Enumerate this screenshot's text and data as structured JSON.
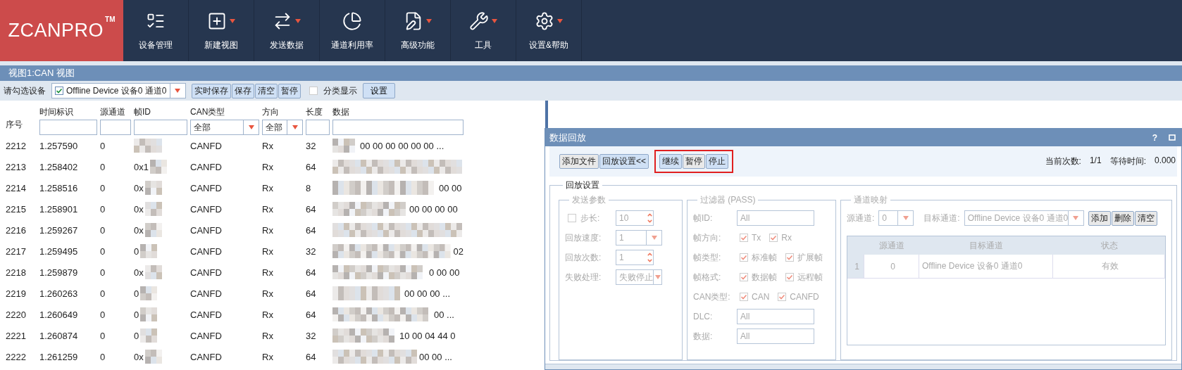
{
  "app": {
    "logo": "ZCANPRO",
    "trademark": "TM"
  },
  "toolbar": [
    {
      "label": "设备管理",
      "dropdown": false
    },
    {
      "label": "新建视图",
      "dropdown": true
    },
    {
      "label": "发送数据",
      "dropdown": true
    },
    {
      "label": "通道利用率",
      "dropdown": false
    },
    {
      "label": "高级功能",
      "dropdown": true
    },
    {
      "label": "工具",
      "dropdown": true
    },
    {
      "label": "设置&帮助",
      "dropdown": true
    }
  ],
  "view": {
    "title": "视图1:CAN 视图",
    "device_label": "请勾选设备",
    "device": {
      "value": "Offline Device 设备0 通道0",
      "checked": true
    },
    "buttons": [
      "实时保存",
      "保存",
      "清空",
      "暂停"
    ],
    "classify": {
      "label": "分类显示",
      "checked": false
    },
    "settings_button": "设置"
  },
  "table": {
    "columns": [
      {
        "label": "序号",
        "kind": "plain"
      },
      {
        "label": "时间标识",
        "kind": "text"
      },
      {
        "label": "源通道",
        "kind": "text"
      },
      {
        "label": "帧ID",
        "kind": "text"
      },
      {
        "label": "CAN类型",
        "kind": "select",
        "value": "全部"
      },
      {
        "label": "方向",
        "kind": "select",
        "value": "全部"
      },
      {
        "label": "长度",
        "kind": "text"
      },
      {
        "label": "数据",
        "kind": "text"
      }
    ],
    "rows": [
      {
        "seq": "2212",
        "time": "1.257590",
        "channel": "0",
        "id": "",
        "type": "CANFD",
        "dir": "Rx",
        "len": "32",
        "data": "00 00 00 00 00 00 ..."
      },
      {
        "seq": "2213",
        "time": "1.258402",
        "channel": "0",
        "id": "0x1",
        "type": "CANFD",
        "dir": "Rx",
        "len": "64",
        "data": ""
      },
      {
        "seq": "2214",
        "time": "1.258516",
        "channel": "0",
        "id": "0x",
        "type": "CANFD",
        "dir": "Rx",
        "len": "8",
        "data": "00 00"
      },
      {
        "seq": "2215",
        "time": "1.258901",
        "channel": "0",
        "id": "0x",
        "type": "CANFD",
        "dir": "Rx",
        "len": "64",
        "data": "00 00 00 00"
      },
      {
        "seq": "2216",
        "time": "1.259267",
        "channel": "0",
        "id": "0x",
        "type": "CANFD",
        "dir": "Rx",
        "len": "64",
        "data": ""
      },
      {
        "seq": "2217",
        "time": "1.259495",
        "channel": "0",
        "id": "0",
        "type": "CANFD",
        "dir": "Rx",
        "len": "32",
        "data": "02"
      },
      {
        "seq": "2218",
        "time": "1.259879",
        "channel": "0",
        "id": "0x",
        "type": "CANFD",
        "dir": "Rx",
        "len": "64",
        "data": "0 00 00"
      },
      {
        "seq": "2219",
        "time": "1.260263",
        "channel": "0",
        "id": "0",
        "type": "CANFD",
        "dir": "Rx",
        "len": "64",
        "data": "00 00 00 ..."
      },
      {
        "seq": "2220",
        "time": "1.260649",
        "channel": "0",
        "id": "0",
        "type": "CANFD",
        "dir": "Rx",
        "len": "64",
        "data": "00 ..."
      },
      {
        "seq": "2221",
        "time": "1.260874",
        "channel": "0",
        "id": "0",
        "type": "CANFD",
        "dir": "Rx",
        "len": "32",
        "data": "10 00 04 44 0"
      },
      {
        "seq": "2222",
        "time": "1.261259",
        "channel": "0",
        "id": "0x",
        "type": "CANFD",
        "dir": "Rx",
        "len": "64",
        "data": "00 00 ..."
      }
    ]
  },
  "playback": {
    "title": "数据回放",
    "help": "?",
    "file_buttons": [
      "添加文件",
      "回放设置<<"
    ],
    "control_buttons": [
      {
        "label": "继续",
        "active": true
      },
      {
        "label": "暂停",
        "active": false
      },
      {
        "label": "停止",
        "active": true
      }
    ],
    "status": {
      "count_label": "当前次数:",
      "count": "1/1",
      "wait_label": "等待时间:",
      "wait": "0.000"
    },
    "settings": {
      "title": "回放设置",
      "disabled": true,
      "send": {
        "title": "发送参数",
        "fields": [
          {
            "label": "步长:",
            "kind": "spin",
            "value": "10",
            "checked": false
          },
          {
            "label": "回放速度:",
            "kind": "select",
            "value": "1"
          },
          {
            "label": "回放次数:",
            "kind": "spin",
            "value": "1"
          },
          {
            "label": "失败处理:",
            "kind": "select",
            "value": "失败停止"
          }
        ]
      },
      "filter": {
        "title": "过滤器 (PASS)",
        "fields": [
          {
            "label": "帧ID:",
            "kind": "text",
            "value": "All"
          },
          {
            "label": "帧方向:",
            "kind": "checks",
            "options": [
              {
                "label": "Tx",
                "checked": true
              },
              {
                "label": "Rx",
                "checked": true
              }
            ]
          },
          {
            "label": "帧类型:",
            "kind": "checks",
            "options": [
              {
                "label": "标准帧",
                "checked": true
              },
              {
                "label": "扩展帧",
                "checked": true
              }
            ]
          },
          {
            "label": "帧格式:",
            "kind": "checks",
            "options": [
              {
                "label": "数据帧",
                "checked": true
              },
              {
                "label": "远程帧",
                "checked": true
              }
            ]
          },
          {
            "label": "CAN类型:",
            "kind": "checks",
            "options": [
              {
                "label": "CAN",
                "checked": true
              },
              {
                "label": "CANFD",
                "checked": true
              }
            ]
          },
          {
            "label": "DLC:",
            "kind": "text",
            "value": "All"
          },
          {
            "label": "数据:",
            "kind": "text",
            "value": "All"
          }
        ]
      },
      "mapping": {
        "title": "通道映射",
        "source_label": "源通道:",
        "source": "0",
        "target_label": "目标通道:",
        "target": "Offline Device 设备0 通道0",
        "buttons": [
          "添加",
          "删除",
          "清空"
        ],
        "columns": [
          "源通道",
          "目标通道",
          "状态"
        ],
        "rows": [
          {
            "index": "1",
            "cells": [
              "0",
              "Offline Device 设备0 通道0",
              "有效"
            ]
          }
        ]
      }
    }
  }
}
